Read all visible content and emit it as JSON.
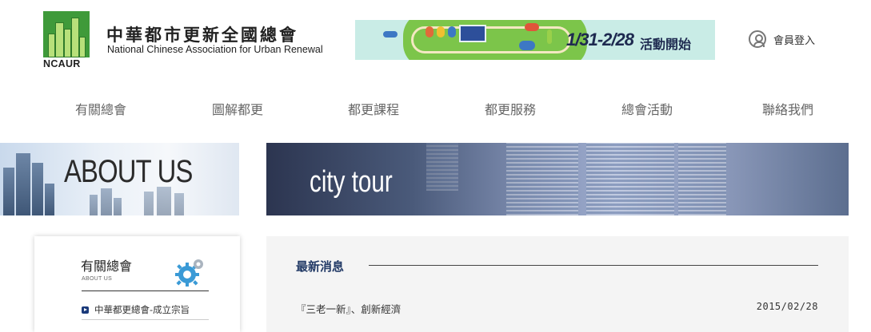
{
  "header": {
    "logo_caption": "NCAUR",
    "org_name_cn": "中華都市更新全國總會",
    "org_name_en": "National Chinese Association for Urban Renewal",
    "banner": {
      "dates": "1/31-2/28",
      "text": "活動開始"
    },
    "login_label": "會員登入"
  },
  "nav": {
    "items": [
      {
        "label": "有關總會"
      },
      {
        "label": "圖解都更"
      },
      {
        "label": "都更課程"
      },
      {
        "label": "都更服務"
      },
      {
        "label": "總會活動"
      },
      {
        "label": "聯絡我們"
      }
    ]
  },
  "hero": {
    "left_text": "ABOUT US",
    "right_text": "city tour"
  },
  "sidebar": {
    "title": "有關總會",
    "subtitle": "ABOUT US",
    "items": [
      {
        "label": "中華都更總會-成立宗旨"
      }
    ]
  },
  "main": {
    "section_title": "最新消息",
    "news": [
      {
        "title": "『三老一新』、創新經濟",
        "date": "2015/02/28"
      }
    ]
  },
  "colors": {
    "nav_text": "#666666",
    "accent_navy": "#223a66",
    "logo_green": "#3f9a3a"
  }
}
